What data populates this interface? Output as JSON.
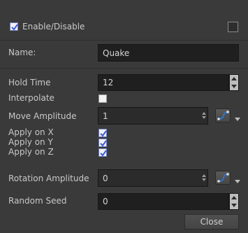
{
  "enable": {
    "label": "Enable/Disable",
    "checked": true,
    "color_swatch_checked": false
  },
  "name": {
    "label": "Name:",
    "value": "Quake"
  },
  "hold_time": {
    "label": "Hold Time",
    "value": "12"
  },
  "interpolate": {
    "label": "Interpolate",
    "checked": false
  },
  "move_amplitude": {
    "label": "Move Amplitude",
    "value": "1"
  },
  "apply_on": [
    {
      "label": "Apply on X",
      "checked": true
    },
    {
      "label": "Apply on Y",
      "checked": true
    },
    {
      "label": "Apply on Z",
      "checked": true
    }
  ],
  "rotation_amplitude": {
    "label": "Rotation Amplitude",
    "value": "0"
  },
  "random_seed": {
    "label": "Random Seed",
    "value": "0"
  },
  "close_label": "Close",
  "icons": {
    "stepper_arrows": "up-down-arrows-icon",
    "function_curve": "function-curve-icon",
    "dropdown": "chevron-down-icon"
  },
  "colors": {
    "background": "#3a3a3a",
    "field": "#1f1f1f",
    "check_accent": "#3d5bd8",
    "curve_accent": "#2f74c8"
  }
}
